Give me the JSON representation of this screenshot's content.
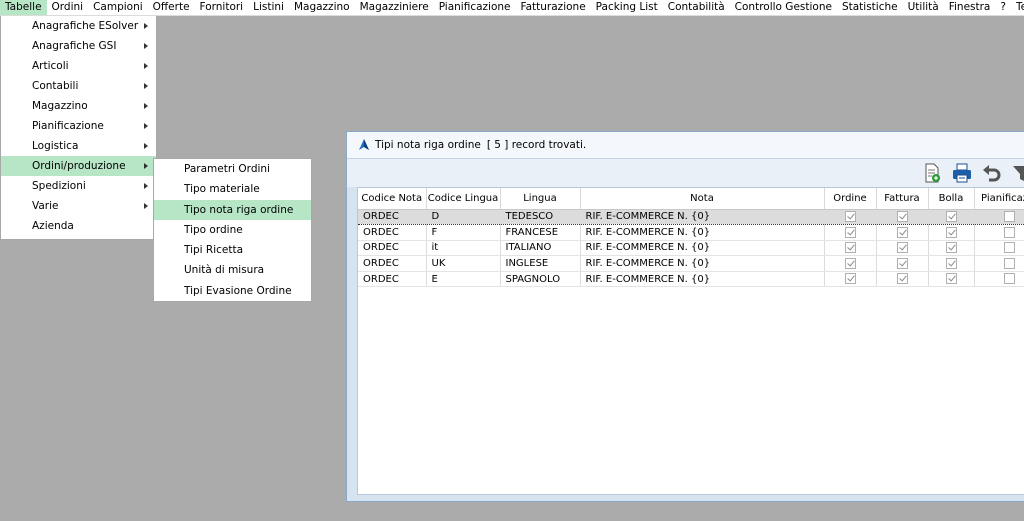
{
  "menubar": [
    {
      "label": "Tabelle",
      "active": true
    },
    {
      "label": "Ordini"
    },
    {
      "label": "Campioni"
    },
    {
      "label": "Offerte"
    },
    {
      "label": "Fornitori"
    },
    {
      "label": "Listini"
    },
    {
      "label": "Magazzino"
    },
    {
      "label": "Magazziniere"
    },
    {
      "label": "Pianificazione"
    },
    {
      "label": "Fatturazione"
    },
    {
      "label": "Packing List"
    },
    {
      "label": "Contabilità"
    },
    {
      "label": "Controllo Gestione"
    },
    {
      "label": "Statistiche"
    },
    {
      "label": "Utilità"
    },
    {
      "label": "Finestra"
    },
    {
      "label": "?"
    },
    {
      "label": "Test eoste"
    }
  ],
  "tabelle_menu": [
    {
      "label": "Anagrafiche ESolver",
      "submenu": true
    },
    {
      "label": "Anagrafiche GSI",
      "submenu": true
    },
    {
      "label": "Articoli",
      "submenu": true
    },
    {
      "label": "Contabili",
      "submenu": true
    },
    {
      "label": "Magazzino",
      "submenu": true
    },
    {
      "label": "Pianificazione",
      "submenu": true
    },
    {
      "label": "Logistica",
      "submenu": true
    },
    {
      "label": "Ordini/produzione",
      "submenu": true,
      "highlighted": true
    },
    {
      "label": "Spedizioni",
      "submenu": true
    },
    {
      "label": "Varie",
      "submenu": true
    },
    {
      "label": "Azienda",
      "submenu": false
    }
  ],
  "ordini_submenu": [
    {
      "label": "Parametri Ordini"
    },
    {
      "label": "Tipo materiale"
    },
    {
      "label": "Tipo nota riga ordine",
      "highlighted": true
    },
    {
      "label": "Tipo ordine"
    },
    {
      "label": "Tipi Ricetta"
    },
    {
      "label": "Unità di misura"
    },
    {
      "label": "Tipi Evasione Ordine"
    }
  ],
  "window": {
    "title": "Tipi nota riga ordine",
    "record_count": "[ 5 ] record trovati.",
    "toolbar": [
      "export-icon",
      "print-icon",
      "undo-icon",
      "filter-icon"
    ]
  },
  "grid": {
    "columns": [
      "Codice Nota",
      "Codice Lingua",
      "Lingua",
      "Nota",
      "Ordine",
      "Fattura",
      "Bolla",
      "Pianificazio"
    ],
    "rows": [
      {
        "codice_nota": "ORDEC",
        "codice_lingua": "D",
        "lingua": "TEDESCO",
        "nota": "RIF. E-COMMERCE N. {0}",
        "ordine": true,
        "fattura": true,
        "bolla": true,
        "pianificazione": false,
        "selected": true
      },
      {
        "codice_nota": "ORDEC",
        "codice_lingua": "F",
        "lingua": "FRANCESE",
        "nota": "RIF. E-COMMERCE N. {0}",
        "ordine": true,
        "fattura": true,
        "bolla": true,
        "pianificazione": false
      },
      {
        "codice_nota": "ORDEC",
        "codice_lingua": "it",
        "lingua": "ITALIANO",
        "nota": "RIF. E-COMMERCE N. {0}",
        "ordine": true,
        "fattura": true,
        "bolla": true,
        "pianificazione": false
      },
      {
        "codice_nota": "ORDEC",
        "codice_lingua": "UK",
        "lingua": "INGLESE",
        "nota": "RIF. E-COMMERCE N. {0}",
        "ordine": true,
        "fattura": true,
        "bolla": true,
        "pianificazione": false
      },
      {
        "codice_nota": "ORDEC",
        "codice_lingua": "E",
        "lingua": "SPAGNOLO",
        "nota": "RIF. E-COMMERCE N. {0}",
        "ordine": true,
        "fattura": true,
        "bolla": true,
        "pianificazione": false
      }
    ]
  },
  "colors": {
    "highlight": "#b7e6c7",
    "desktop": "#ababab",
    "window_frame": "#d6e4f2"
  }
}
